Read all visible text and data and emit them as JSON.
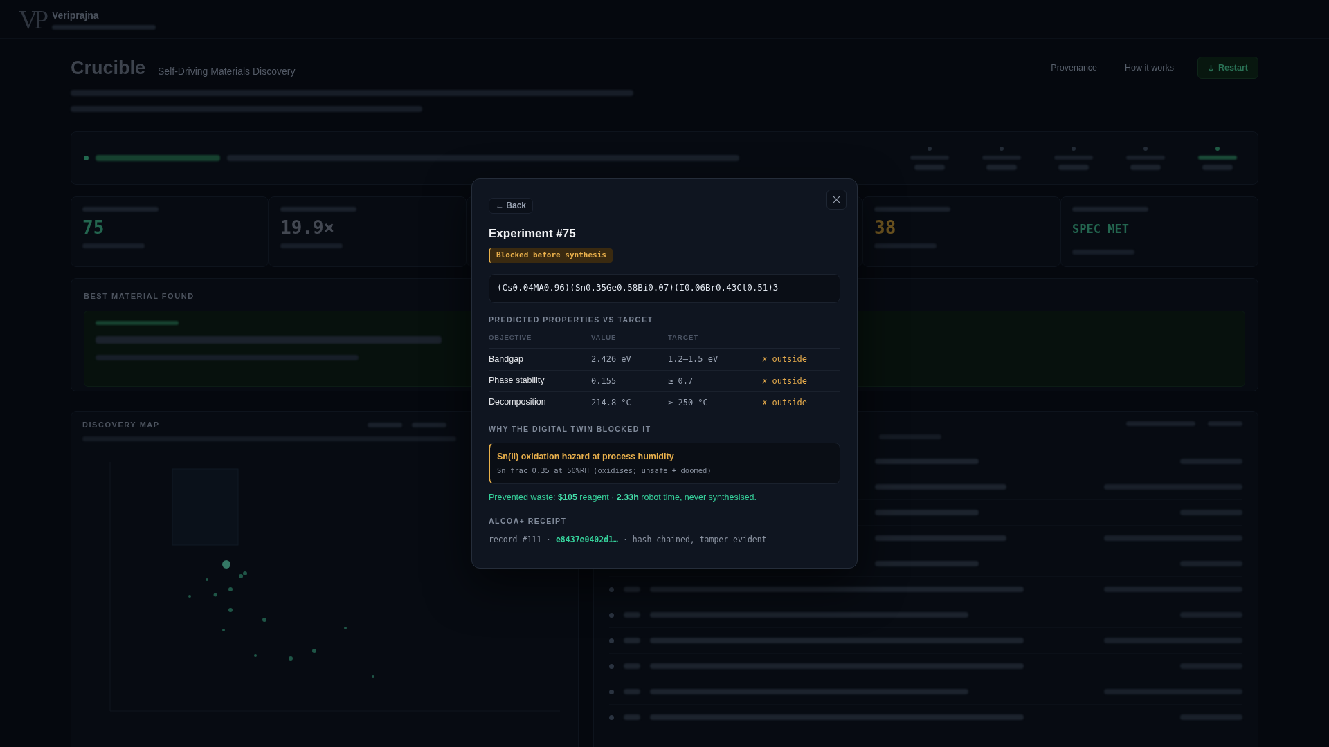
{
  "backdrop": {
    "logo": "VP",
    "brand": "Veriprajna",
    "title": "Crucible",
    "subtitle": "Self-Driving Materials Discovery",
    "nav": [
      "Provenance",
      "How it works"
    ],
    "action": "Restart",
    "stat_cards_left": [
      {
        "value": "75",
        "kind": "good"
      },
      {
        "value": "19.9×",
        "kind": "plain"
      }
    ],
    "stat_cards_right": [
      {
        "value": "38",
        "kind": "warn"
      },
      {
        "value": "SPEC MET",
        "kind": "verdict"
      }
    ],
    "best_heading": "BEST MATERIAL FOUND",
    "map_heading": "DISCOVERY MAP"
  },
  "dialog": {
    "back": "← Back",
    "title": "Experiment #75",
    "status_badge": "Blocked before synthesis",
    "formula": "(Cs0.04MA0.96)(Sn0.35Ge0.58Bi0.07)(I0.06Br0.43Cl0.51)3",
    "properties": {
      "heading": "PREDICTED PROPERTIES VS TARGET",
      "columns": [
        "OBJECTIVE",
        "VALUE",
        "TARGET"
      ],
      "rows": [
        {
          "objective": "Bandgap",
          "value": "2.426 eV",
          "target": "1.2–1.5 eV",
          "verdict": "✗ outside",
          "within": false
        },
        {
          "objective": "Phase stability",
          "value": "0.155",
          "target": "≥ 0.7",
          "verdict": "✗ outside",
          "within": false
        },
        {
          "objective": "Decomposition",
          "value": "214.8 °C",
          "target": "≥ 250 °C",
          "verdict": "✗ outside",
          "within": false
        }
      ]
    },
    "reason": {
      "heading": "WHY THE DIGITAL TWIN BLOCKED IT",
      "title": "Sn(II) oxidation hazard at process humidity",
      "detail": "Sn frac 0.35 at 50%RH (oxidises; unsafe + doomed)"
    },
    "savings": "Prevented waste: **$105** reagent · **2.33h** robot time, never synthesised.",
    "receipt": {
      "heading": "ALCOA+ RECEIPT",
      "line": "record #111 · **e8437e0402d1…** · hash-chained, tamper-evident"
    }
  }
}
